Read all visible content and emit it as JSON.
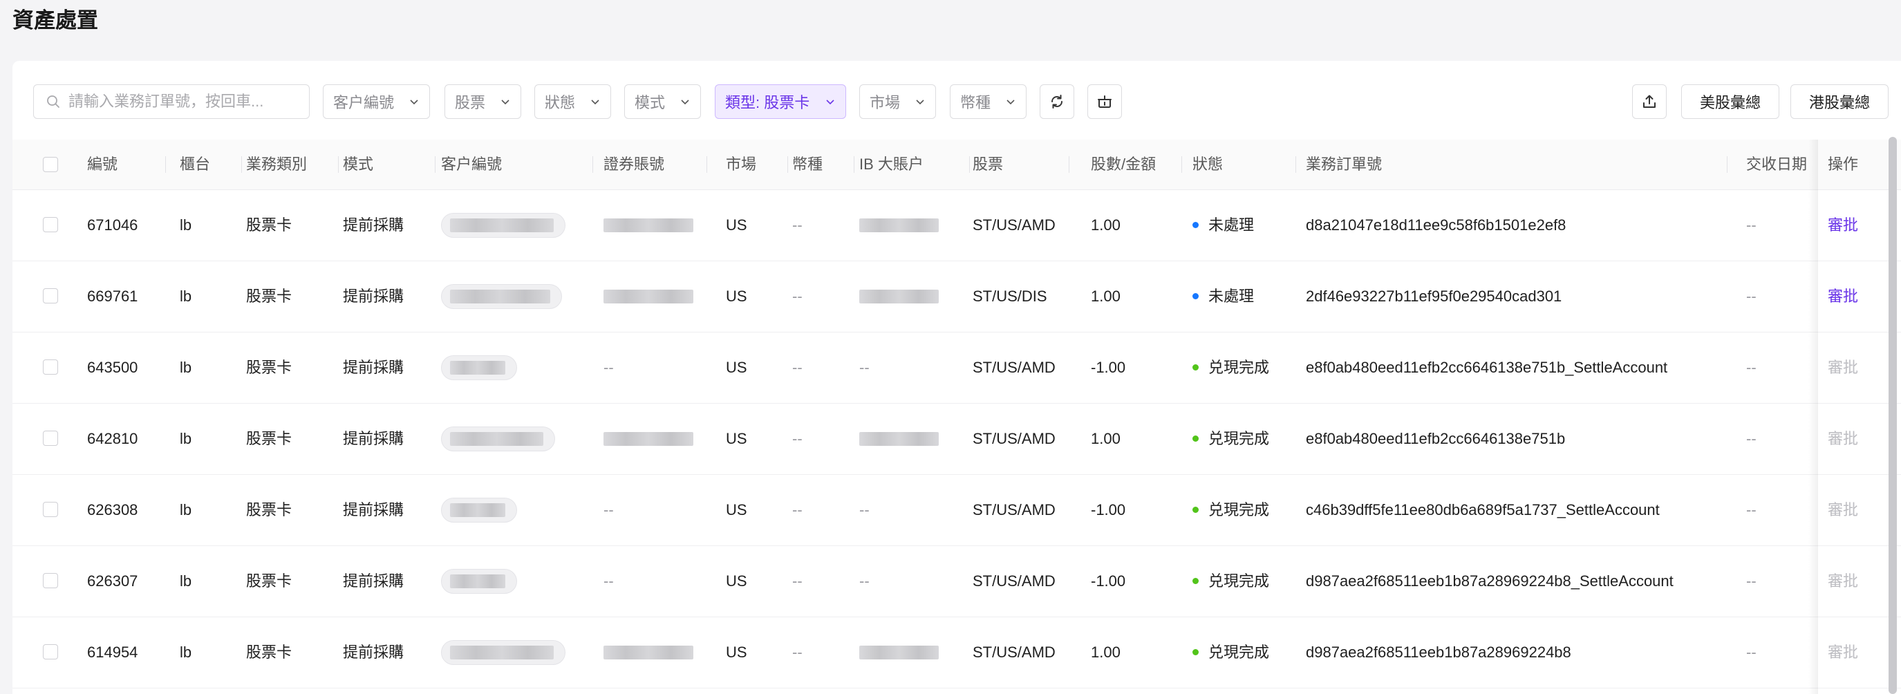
{
  "page": {
    "title": "資產處置"
  },
  "toolbar": {
    "search_placeholder": "請輸入業務訂單號，按回車...",
    "filters": [
      "客户編號",
      "股票",
      "狀態",
      "模式"
    ],
    "type_filter_label": "類型: 股票卡",
    "filters2": [
      "市場",
      "幣種"
    ],
    "us_summary_label": "美股彙總",
    "hk_summary_label": "港股彙總"
  },
  "table": {
    "columns": [
      "編號",
      "櫃台",
      "業務類別",
      "模式",
      "客户編號",
      "證券賬號",
      "市場",
      "幣種",
      "IB 大賬户",
      "股票",
      "股數/金額",
      "狀態",
      "業務訂單號",
      "交收日期",
      "操作"
    ],
    "rows": [
      {
        "id": "671046",
        "counter": "lb",
        "category": "股票卡",
        "mode": "提前採購",
        "account": "",
        "market": "US",
        "currency": "--",
        "ib": "",
        "stock": "ST/US/AMD",
        "amount": "1.00",
        "status": "未處理",
        "status_color": "#1677ff",
        "order": "d8a21047e18d11ee9c58f6b1501e2ef8",
        "settle": "--",
        "action": "審批",
        "action_enabled": true
      },
      {
        "id": "669761",
        "counter": "lb",
        "category": "股票卡",
        "mode": "提前採購",
        "account": "",
        "market": "US",
        "currency": "--",
        "ib": "",
        "stock": "ST/US/DIS",
        "amount": "1.00",
        "status": "未處理",
        "status_color": "#1677ff",
        "order": "2df46e93227b11ef95f0e29540cad301",
        "settle": "--",
        "action": "審批",
        "action_enabled": true
      },
      {
        "id": "643500",
        "counter": "lb",
        "category": "股票卡",
        "mode": "提前採購",
        "account": "--",
        "market": "US",
        "currency": "--",
        "ib": "--",
        "stock": "ST/US/AMD",
        "amount": "-1.00",
        "status": "兑現完成",
        "status_color": "#52c41a",
        "order": "e8f0ab480eed11efb2cc6646138e751b_SettleAccount",
        "settle": "--",
        "action": "審批",
        "action_enabled": false
      },
      {
        "id": "642810",
        "counter": "lb",
        "category": "股票卡",
        "mode": "提前採購",
        "account": "",
        "market": "US",
        "currency": "--",
        "ib": "",
        "stock": "ST/US/AMD",
        "amount": "1.00",
        "status": "兑現完成",
        "status_color": "#52c41a",
        "order": "e8f0ab480eed11efb2cc6646138e751b",
        "settle": "--",
        "action": "審批",
        "action_enabled": false
      },
      {
        "id": "626308",
        "counter": "lb",
        "category": "股票卡",
        "mode": "提前採購",
        "account": "--",
        "market": "US",
        "currency": "--",
        "ib": "--",
        "stock": "ST/US/AMD",
        "amount": "-1.00",
        "status": "兑現完成",
        "status_color": "#52c41a",
        "order": "c46b39dff5fe11ee80db6a689f5a1737_SettleAccount",
        "settle": "--",
        "action": "審批",
        "action_enabled": false
      },
      {
        "id": "626307",
        "counter": "lb",
        "category": "股票卡",
        "mode": "提前採購",
        "account": "--",
        "market": "US",
        "currency": "--",
        "ib": "--",
        "stock": "ST/US/AMD",
        "amount": "-1.00",
        "status": "兑現完成",
        "status_color": "#52c41a",
        "order": "d987aea2f68511eeb1b87a28969224b8_SettleAccount",
        "settle": "--",
        "action": "審批",
        "action_enabled": false
      },
      {
        "id": "614954",
        "counter": "lb",
        "category": "股票卡",
        "mode": "提前採購",
        "account": "",
        "market": "US",
        "currency": "--",
        "ib": "",
        "stock": "ST/US/AMD",
        "amount": "1.00",
        "status": "兑現完成",
        "status_color": "#52c41a",
        "order": "d987aea2f68511eeb1b87a28969224b8",
        "settle": "--",
        "action": "審批",
        "action_enabled": false
      }
    ]
  }
}
